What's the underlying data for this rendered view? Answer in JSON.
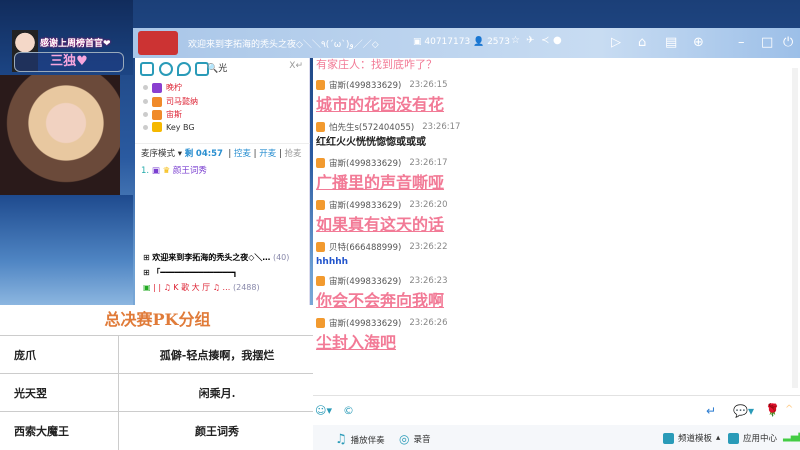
{
  "overlay": {
    "title": "感谢上周榜首官❤",
    "name": "三独♥"
  },
  "header": {
    "title": "欢迎来到李拓海的秃头之夜◇＼＼٩(ˊωˋ)و／／◇",
    "room_id": "40717173",
    "viewers": "2573"
  },
  "search": {
    "value": "光",
    "clear": "X↵"
  },
  "users": [
    {
      "name": "晚柠",
      "color": "#d23"
    },
    {
      "name": "司马懿纳",
      "color": "#d23"
    },
    {
      "name": "宙斯",
      "color": "#d23"
    },
    {
      "name": "Key BG",
      "color": "#333"
    }
  ],
  "mic": {
    "mode": "麦序模式",
    "remaining_label": "剩",
    "time": "04:57",
    "actions": [
      "控麦",
      "开麦",
      "抢麦"
    ],
    "queue": [
      {
        "index": "1.",
        "name": "颜王词秀"
      }
    ]
  },
  "rooms": [
    {
      "name": "欢迎来到李拓海的秃头之夜◇＼…",
      "count": "(40)"
    },
    {
      "name": "「━━━━━━━━━━━━━━━┓",
      "count": ""
    },
    {
      "name": "| | ♫ K 歌 大 厅 ♫ …",
      "count": "(2488)"
    }
  ],
  "table": {
    "title": "总决赛PK分组",
    "rows": [
      [
        "庞爪",
        "孤僻-轻点揍啊，我摆烂"
      ],
      [
        "光天翌",
        "闲乘月."
      ],
      [
        "西索大魔王",
        "颜王词秀"
      ]
    ]
  },
  "chat": {
    "partial": "有家庄人：找到底咋了？",
    "messages": [
      {
        "user": "宙斯(499833629)",
        "time": "23:26:15",
        "text": "城市的花园没有花",
        "style": "big"
      },
      {
        "user": "怕先生s(572404055)",
        "time": "23:26:17",
        "text": "红红火火恍恍惚惚或或或",
        "style": "blk"
      },
      {
        "user": "宙斯(499833629)",
        "time": "23:26:17",
        "text": "广播里的声音嘶哑",
        "style": "big"
      },
      {
        "user": "宙斯(499833629)",
        "time": "23:26:20",
        "text": "如果真有这天的话",
        "style": "big"
      },
      {
        "user": "贝特(666488999)",
        "time": "23:26:22",
        "text": "hhhhh",
        "style": "blu"
      },
      {
        "user": "宙斯(499833629)",
        "time": "23:26:23",
        "text": "你会不会奔向我啊",
        "style": "big"
      },
      {
        "user": "宙斯(499833629)",
        "time": "23:26:26",
        "text": "尘封入海吧",
        "style": "big"
      }
    ]
  },
  "bottom": {
    "accompany": "播放伴奏",
    "record": "录音",
    "channel_template": "频道模板",
    "app_center": "应用中心"
  }
}
